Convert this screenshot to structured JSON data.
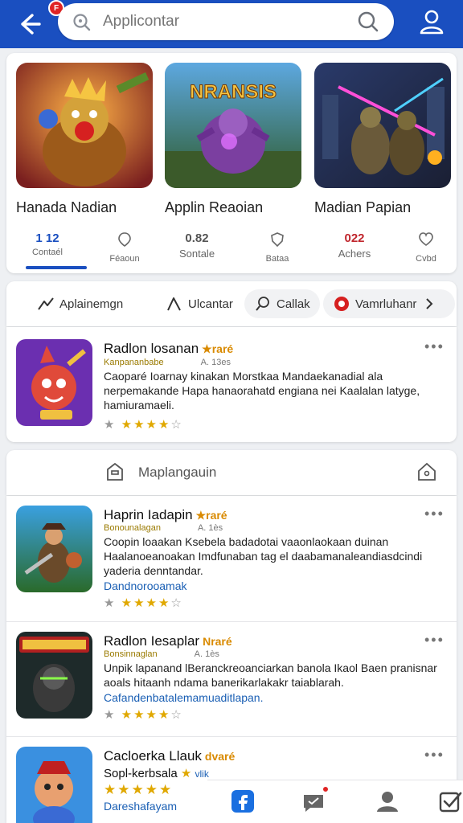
{
  "header": {
    "badge": "F",
    "search_placeholder": "Applicontar"
  },
  "featured": [
    {
      "title": "Hanada Nadian",
      "image_text": ""
    },
    {
      "title": "Applin Reaoian",
      "image_text": "NRANSIS"
    },
    {
      "title": "Madian Papian",
      "image_text": ""
    }
  ],
  "stats": [
    {
      "value": "1 12",
      "label": "Contaél"
    },
    {
      "value": "",
      "label": "Féaoun"
    },
    {
      "value": "0.82",
      "label": "Sontale"
    },
    {
      "value": "",
      "label": "Bataa"
    },
    {
      "value": "022",
      "label": "Achers"
    },
    {
      "value": "",
      "label": "Cvbd"
    }
  ],
  "filters": [
    {
      "label": "Aplainemgn",
      "icon": "trend-icon"
    },
    {
      "label": "Ulcantar",
      "icon": "chart-icon"
    },
    {
      "label": "Callak",
      "icon": "search-icon"
    },
    {
      "label": "Vamrluhanr",
      "icon": "alert-icon"
    }
  ],
  "apps": [
    {
      "title": "Radlon losanan",
      "tag": "★raré",
      "meta_dev": "Kanpananbabe",
      "meta_ver": "A. 13es",
      "desc": "Caoparé Ioarnay kinakan Morstkaa Mandaekanadial ala nerpemakande Hapa hanaorahatd engiana nei Kaalalan latyge, hamiuramaeli.",
      "link": "",
      "rating_full": "★★★★",
      "rating_empty": "☆"
    },
    {
      "title": "Haprin Iadapin",
      "tag": "★raré",
      "meta_dev": "Bonounalagan",
      "meta_ver": "A. 1ès",
      "desc": "Coopin loaakan Ksebela badadotai vaaonlaokaan duinan Haalanoeanoakan Imdfunaban tag el daabamanaleandiasdcindi yaderia denntandar.",
      "link": "Dandnorooamak",
      "rating_full": "★★★★",
      "rating_empty": "☆"
    },
    {
      "title": "Radlon Iesaplar",
      "tag": "Nraré",
      "meta_dev": "Bonsinnaglan",
      "meta_ver": "A. 1ès",
      "desc": "Unpik lapanand lBeranckreoanciarkan banola Ikaol Baen pranisnar aoals hitaanh ndama banerikarlakakr taiablarah.",
      "link": "Cafandenbatalemamuaditlapan.",
      "rating_full": "★★★★",
      "rating_empty": "☆"
    },
    {
      "title": "Cacloerka Llauk",
      "tag": "dvaré",
      "meta_dev": "Sopl-kerbsala",
      "meta_ver": "vlik",
      "desc": "",
      "link": "Dareshafayam",
      "rating_full": "★★★★★",
      "rating_empty": ""
    }
  ],
  "section": {
    "title": "Maplangauin"
  },
  "colors": {
    "brand": "#1a4fc0",
    "star": "#e0a800",
    "badge": "#e02424"
  }
}
